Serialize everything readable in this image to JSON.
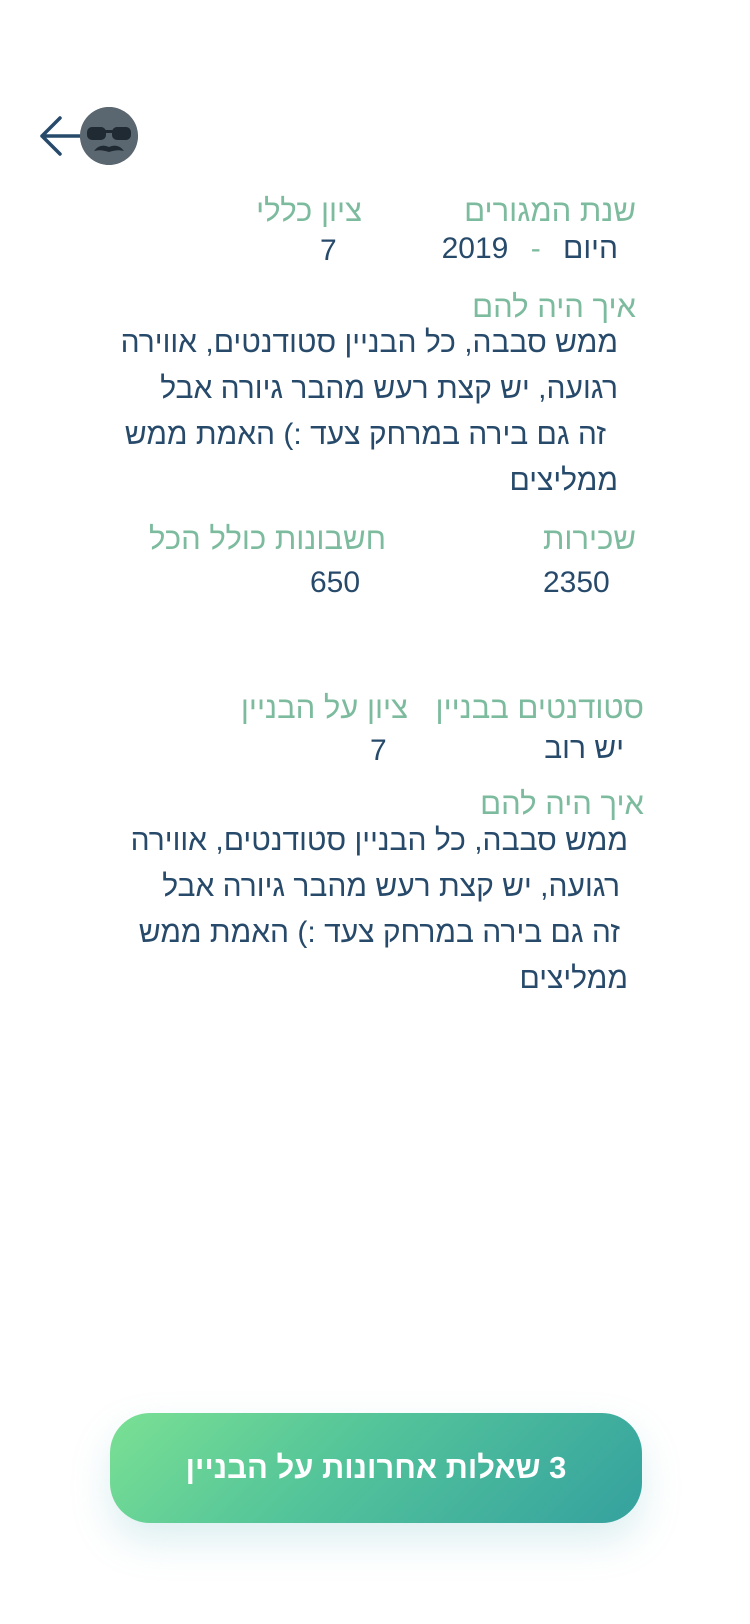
{
  "header": {
    "back_icon": "arrow-left-icon",
    "avatar_icon": "glasses-mustache-avatar"
  },
  "section1": {
    "years_label": "שנת המגורים",
    "years_from": "2019",
    "years_sep": "-",
    "years_to": "היום",
    "score_label": "ציון כללי",
    "score_value": "7",
    "how_label": "איך היה להם",
    "how_lines": [
      "ממש סבבה, כל הבניין סטודנטים, אווירה",
      "רגועה, יש קצת רעש מהבר גיורה אבל",
      "זה גם בירה במרחק צעד :) האמת ממש",
      "ממליצים"
    ],
    "rent_label": "שכירות",
    "rent_value": "2350",
    "bills_label": "חשבונות כולל הכל",
    "bills_value": "650"
  },
  "section2": {
    "students_label": "סטודנטים בבניין",
    "students_value": "יש רוב",
    "building_score_label": "ציון על הבניין",
    "building_score_value": "7",
    "how_label": "איך היה להם",
    "how_lines": [
      "ממש סבבה, כל הבניין סטודנטים, אווירה",
      "רגועה, יש קצת רעש מהבר גיורה אבל",
      "זה גם בירה במרחק צעד :) האמת ממש",
      "ממליצים"
    ]
  },
  "cta": {
    "label": "3 שאלות אחרונות על הבניין"
  },
  "colors": {
    "label": "#7dbb9e",
    "text": "#274a6b",
    "cta_start": "#7ae093",
    "cta_end": "#35a19f"
  }
}
